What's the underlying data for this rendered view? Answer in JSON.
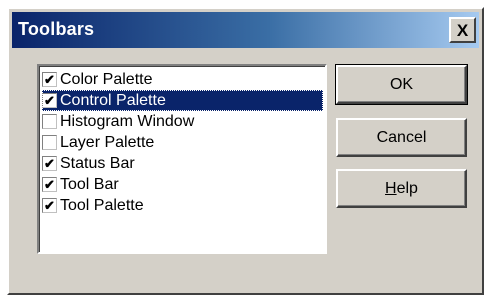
{
  "dialog": {
    "title": "Toolbars",
    "close_glyph": "X"
  },
  "toolbar_list": {
    "items": [
      {
        "label": "Color Palette",
        "checked": true,
        "selected": false
      },
      {
        "label": "Control Palette",
        "checked": true,
        "selected": true
      },
      {
        "label": "Histogram Window",
        "checked": false,
        "selected": false
      },
      {
        "label": "Layer Palette",
        "checked": false,
        "selected": false
      },
      {
        "label": "Status Bar",
        "checked": true,
        "selected": false
      },
      {
        "label": "Tool Bar",
        "checked": true,
        "selected": false
      },
      {
        "label": "Tool Palette",
        "checked": true,
        "selected": false
      }
    ]
  },
  "buttons": {
    "ok_label": "OK",
    "cancel_label": "Cancel",
    "help_label": "Help"
  },
  "colors": {
    "title_bar": "#0a246a",
    "selection": "#0a246a",
    "face": "#d4d0c8"
  }
}
